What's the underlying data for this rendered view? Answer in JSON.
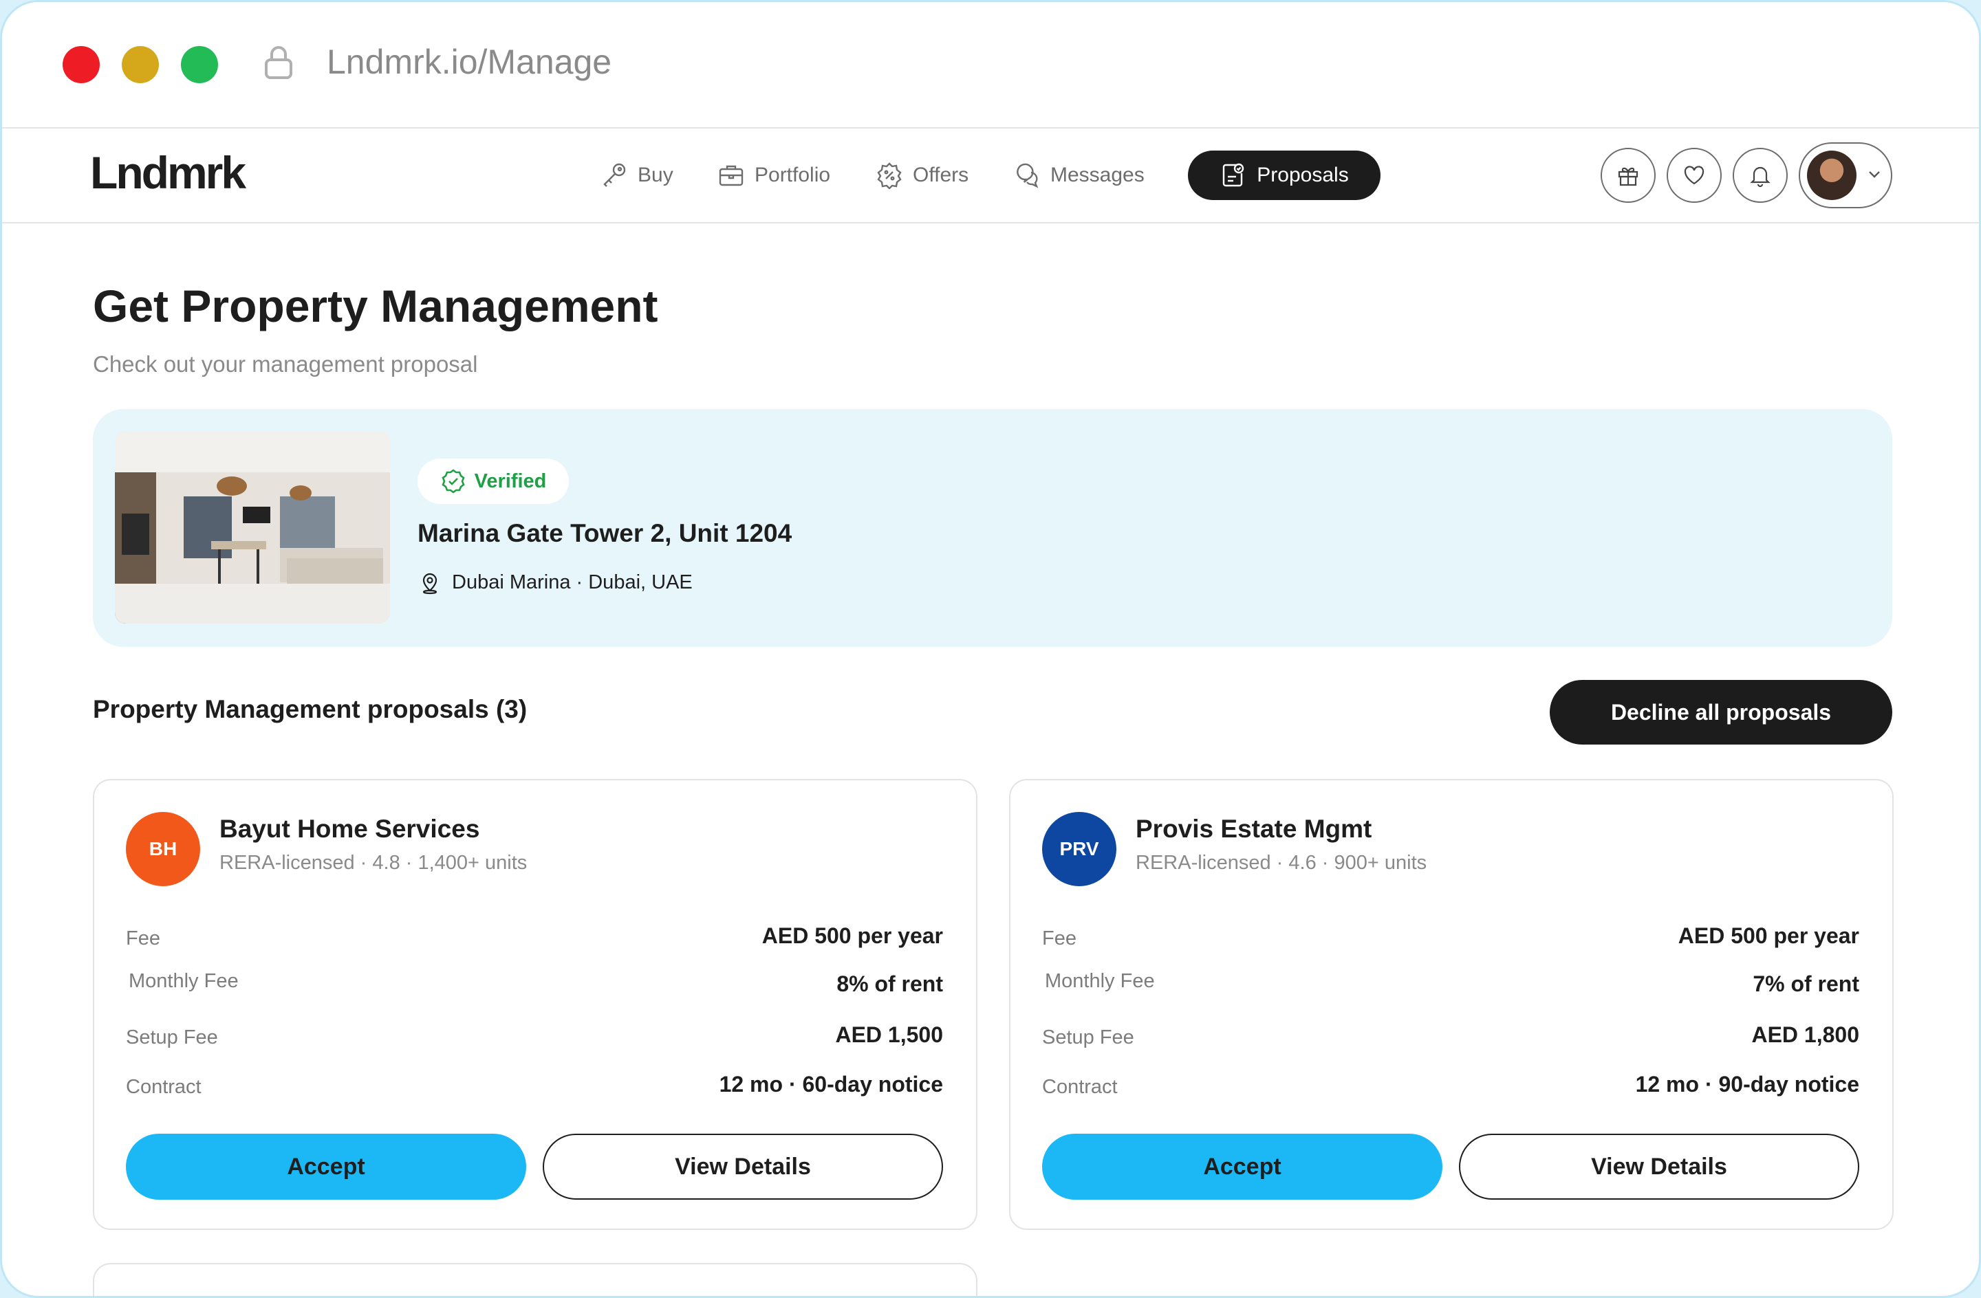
{
  "browser": {
    "url": "Lndmrk.io/Manage",
    "lights": [
      "#ee1c24",
      "#d4a81a",
      "#22bb55"
    ]
  },
  "nav": {
    "logo": "Lndmrk",
    "items": [
      {
        "label": "Buy",
        "icon": "key-icon"
      },
      {
        "label": "Portfolio",
        "icon": "briefcase-icon"
      },
      {
        "label": "Offers",
        "icon": "discount-badge-icon"
      },
      {
        "label": "Messages",
        "icon": "chat-bubbles-icon"
      },
      {
        "label": "Proposals",
        "icon": "proposal-document-icon",
        "active": true
      }
    ],
    "action_icons": [
      "gift-icon",
      "heart-icon",
      "bell-icon"
    ]
  },
  "page": {
    "title": "Get Property Management",
    "subtitle": "Check out your management proposal"
  },
  "property": {
    "badge": "Verified",
    "name": "Marina Gate Tower 2, Unit 1204",
    "location": "Dubai Marina · Dubai, UAE"
  },
  "proposals": {
    "heading": "Property Management proposals (3)",
    "decline_label": "Decline all proposals",
    "cards": [
      {
        "initials": "BH",
        "logo_color": "#f2581a",
        "name": "Bayut Home Services",
        "meta": "RERA-licensed · 4.8 · 1,400+ units",
        "rows": [
          {
            "k": "Fee",
            "v": "AED 500 per year"
          },
          {
            "k": "Monthly Fee",
            "v": "8% of rent"
          },
          {
            "k": "Setup Fee",
            "v": "AED 1,500"
          },
          {
            "k": "Contract",
            "v": "12 mo · 60-day notice"
          }
        ],
        "accept": "Accept",
        "details": "View Details"
      },
      {
        "initials": "PRV",
        "logo_color": "#0d47a1",
        "name": "Provis Estate Mgmt",
        "meta": "RERA-licensed · 4.6 · 900+ units",
        "rows": [
          {
            "k": "Fee",
            "v": "AED 500 per year"
          },
          {
            "k": "Monthly Fee",
            "v": "7% of rent"
          },
          {
            "k": "Setup Fee",
            "v": "AED 1,800"
          },
          {
            "k": "Contract",
            "v": "12 mo · 90-day notice"
          }
        ],
        "accept": "Accept",
        "details": "View Details"
      }
    ]
  }
}
